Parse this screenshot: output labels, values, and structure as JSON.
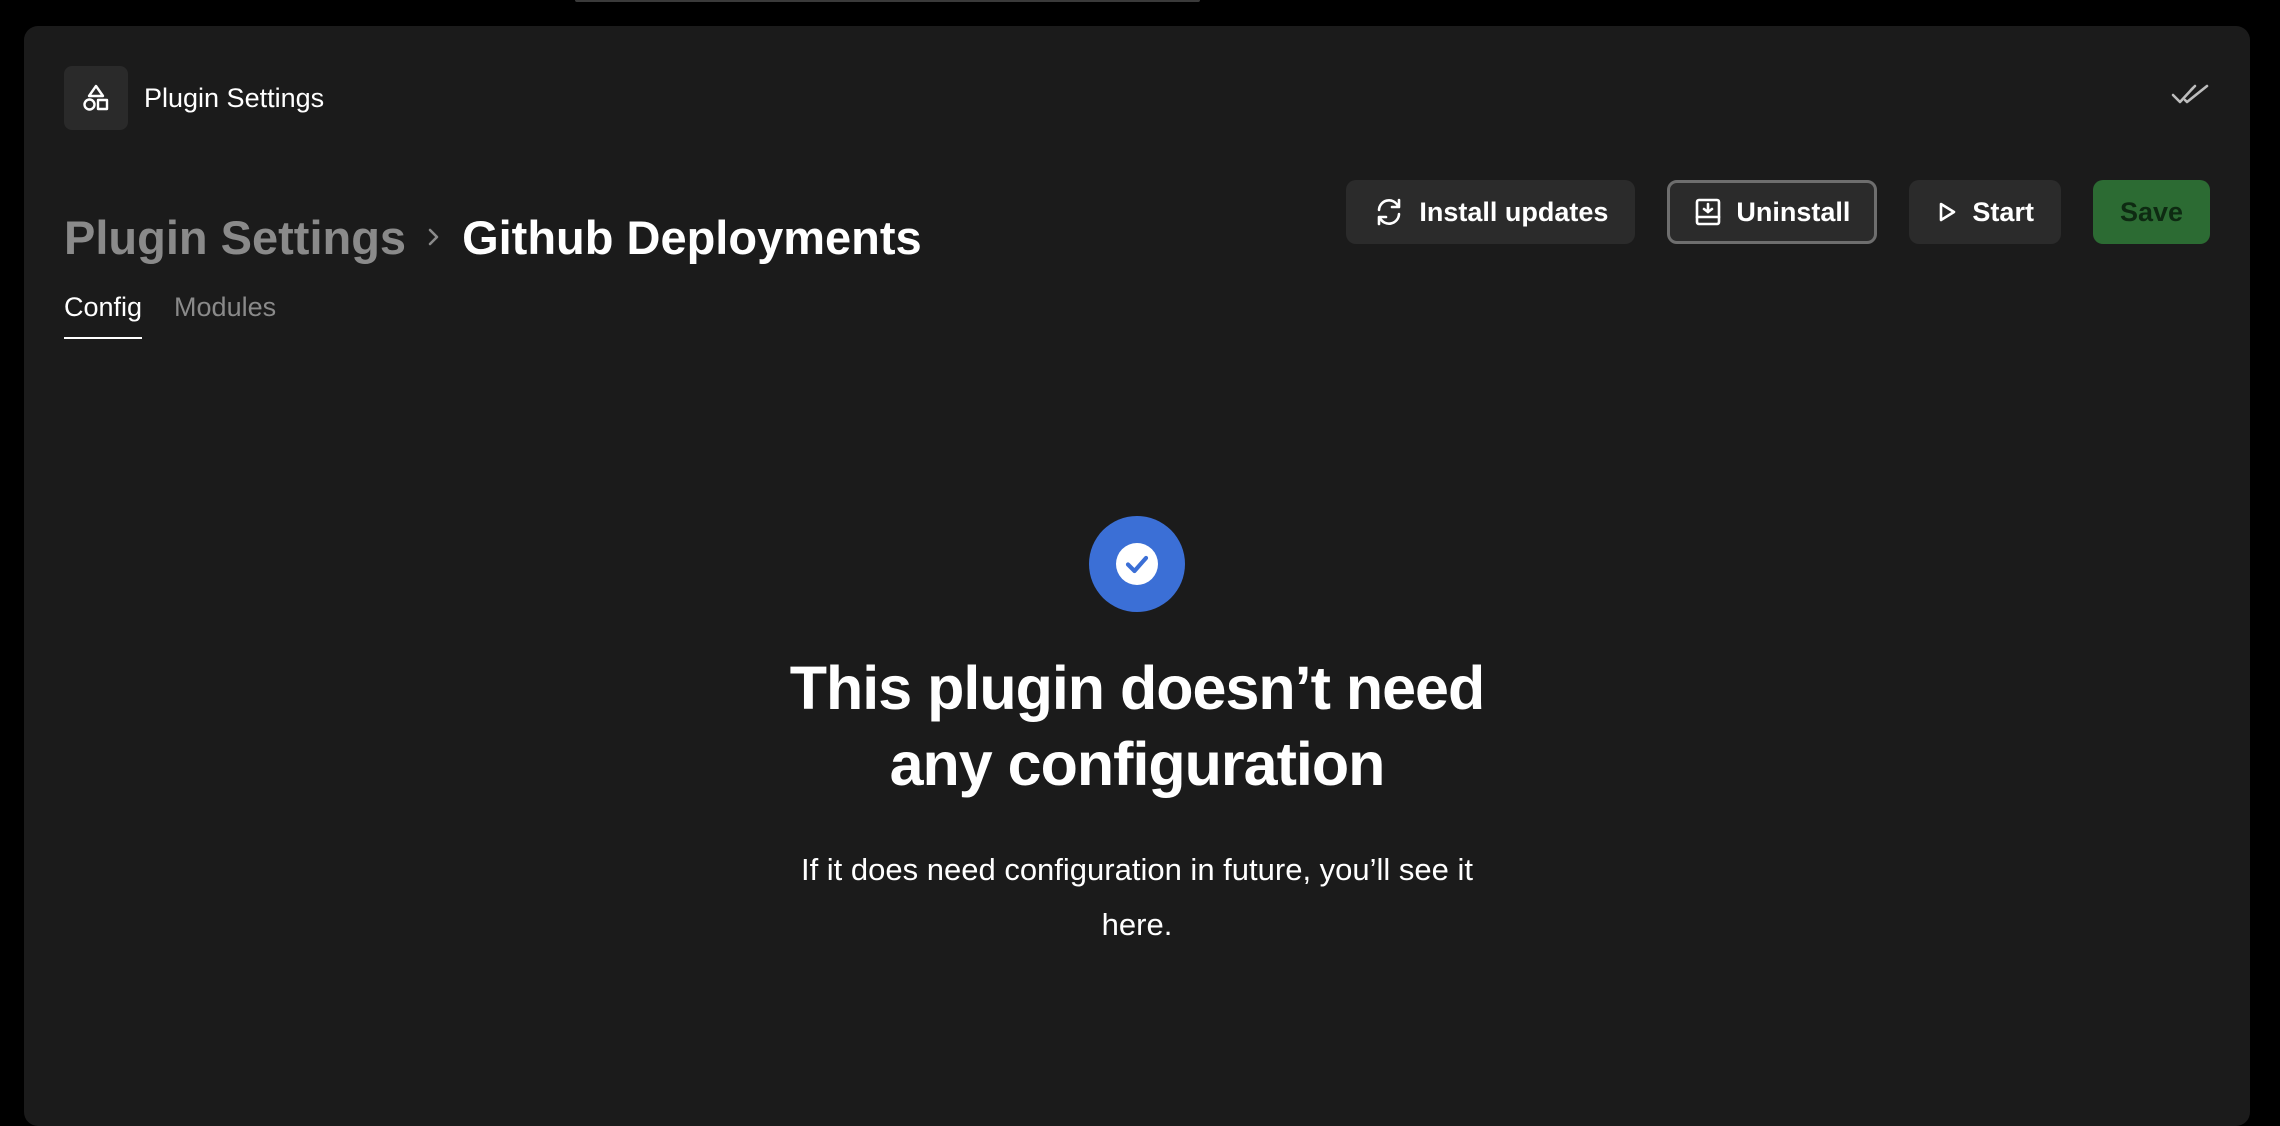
{
  "header": {
    "app_title": "Plugin Settings",
    "app_icon": "shapes-icon",
    "right_icon": "double-check-icon"
  },
  "breadcrumb": {
    "parent": "Plugin Settings",
    "separator_icon": "chevron-right-icon",
    "current": "Github Deployments"
  },
  "toolbar": {
    "install_updates_label": "Install updates",
    "install_updates_icon": "refresh-icon",
    "uninstall_label": "Uninstall",
    "uninstall_icon": "uninstall-icon",
    "start_label": "Start",
    "start_icon": "play-icon",
    "save_label": "Save"
  },
  "tabs": [
    {
      "label": "Config",
      "active": true
    },
    {
      "label": "Modules",
      "active": false
    }
  ],
  "empty_state": {
    "icon": "check-circle-icon",
    "title": "This plugin doesn’t need any configuration",
    "description": "If it does need configuration in future, you’ll see it here."
  },
  "colors": {
    "background": "#000000",
    "panel": "#1b1b1b",
    "button": "#2b2b2b",
    "save_button": "#2c6b33",
    "accent_blue": "#3b6fd6",
    "muted_text": "#8a8a8a"
  }
}
